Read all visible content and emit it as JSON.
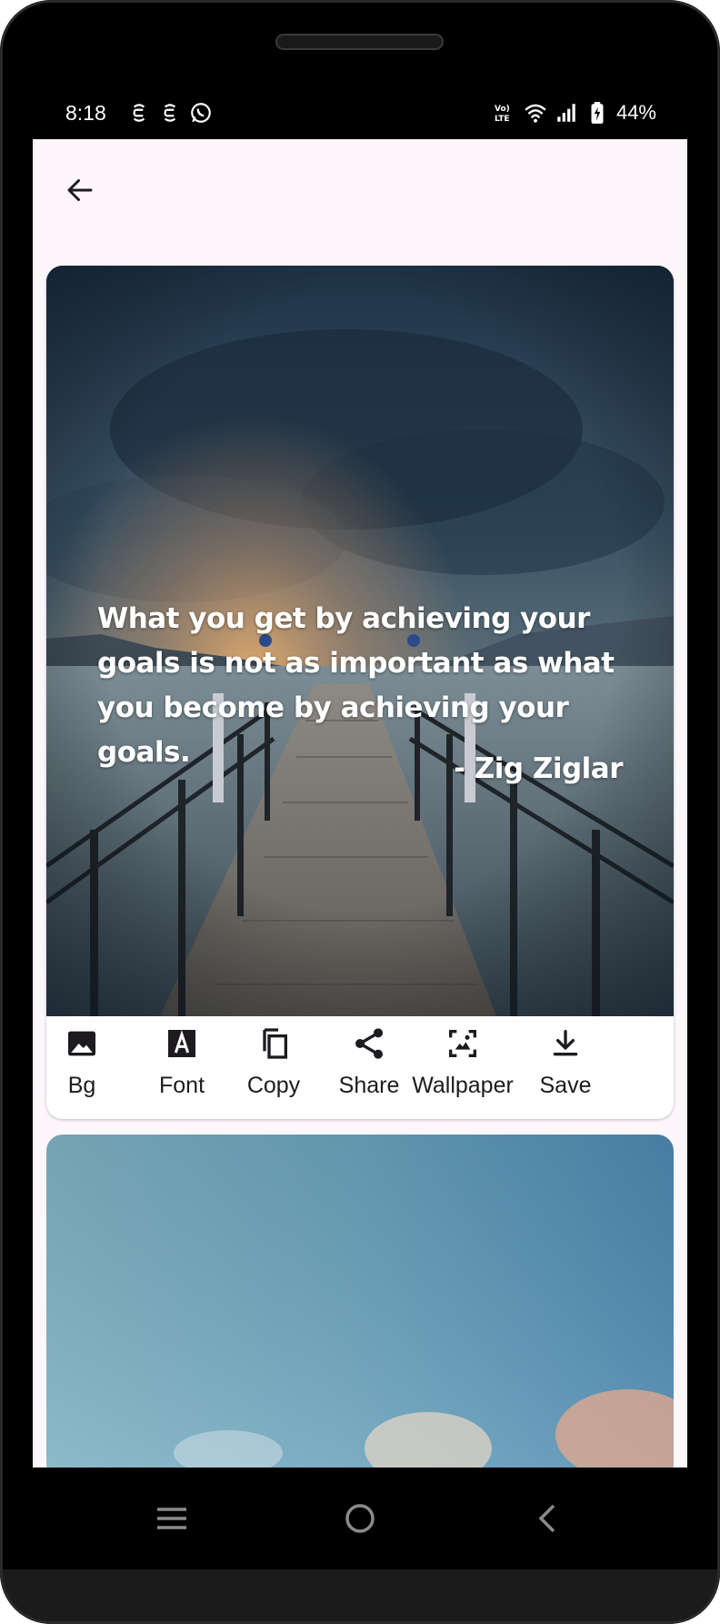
{
  "status_bar": {
    "time": "8:18",
    "battery_percent": "44%",
    "left_icons": [
      "sync-s-icon",
      "sync-s-icon",
      "whatsapp-icon"
    ],
    "right_icons": [
      "volte-icon",
      "wifi-icon",
      "signal-icon",
      "battery-charging-icon"
    ]
  },
  "app_bar": {
    "back_icon": "arrow-back-icon"
  },
  "quote_card": {
    "quote": "What you get by achieving your goals is not as important as what you become by achieving your goals.",
    "author": "- Zig Ziglar",
    "background": "pier-lake-cloudy-sky-image",
    "actions": [
      {
        "label": "Bg",
        "icon": "image-icon"
      },
      {
        "label": "Font",
        "icon": "font-icon"
      },
      {
        "label": "Copy",
        "icon": "copy-icon"
      },
      {
        "label": "Share",
        "icon": "share-icon"
      },
      {
        "label": "Wallpaper",
        "icon": "wallpaper-icon"
      },
      {
        "label": "Save",
        "icon": "download-icon"
      }
    ]
  },
  "next_card": {
    "background": "blue-sky-clouds-image"
  },
  "nav_bar": {
    "buttons": [
      "recents-icon",
      "home-icon",
      "back-icon"
    ]
  },
  "colors": {
    "screen_background": "#fdf7fc",
    "text_primary": "#1d1b20",
    "quote_text": "#ffffff"
  }
}
